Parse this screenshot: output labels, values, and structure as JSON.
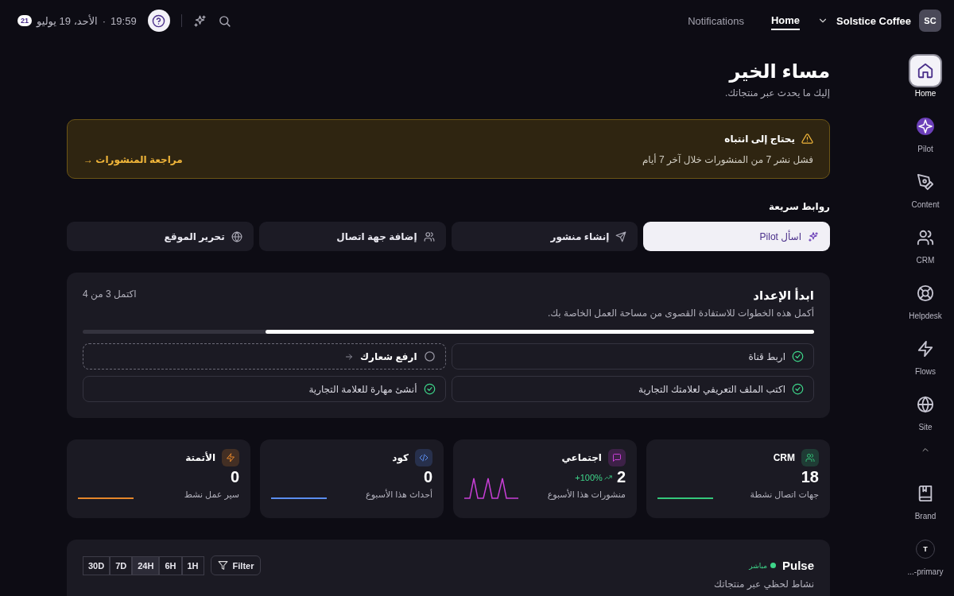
{
  "topbar": {
    "avatar": "SC",
    "workspace": "Solstice Coffee",
    "nav": [
      {
        "label": "Home",
        "selected": true
      },
      {
        "label": "Notifications",
        "selected": false
      }
    ],
    "time": "19:59",
    "separator": "·",
    "date": "الأحد، 19 يوليو",
    "badge": "21"
  },
  "sidebar": {
    "items": [
      {
        "label": "Home",
        "selected": true
      },
      {
        "label": "Pilot",
        "selected": false
      },
      {
        "label": "Content",
        "selected": false
      },
      {
        "label": "CRM",
        "selected": false
      },
      {
        "label": "Helpdesk",
        "selected": false
      },
      {
        "label": "Flows",
        "selected": false
      },
      {
        "label": "Site",
        "selected": false
      }
    ],
    "bottom": [
      {
        "kind": "icon",
        "label": "Brand"
      },
      {
        "kind": "avatar",
        "avatar": "T",
        "label": "...-primary"
      }
    ]
  },
  "greeting": {
    "title": "مساء الخير",
    "subtitle": "إليك ما يحدث عبر منتجاتك."
  },
  "alert": {
    "title": "يحتاج إلى انتباه",
    "text": "فشل نشر 7 من المنشورات خلال آخر 7 أيام",
    "link": "مراجعة المنشورات →"
  },
  "quick_links": {
    "title": "روابط سريعة",
    "items": [
      {
        "label": "اسأل Pilot",
        "primary": true
      },
      {
        "label": "إنشاء منشور",
        "primary": false
      },
      {
        "label": "إضافة جهة اتصال",
        "primary": false
      },
      {
        "label": "تحرير الموقع",
        "primary": false
      }
    ]
  },
  "setup": {
    "title": "ابدأ الإعداد",
    "subtitle": "أكمل هذه الخطوات للاستفادة القصوى من مساحة العمل الخاصة بك.",
    "count": "اكتمل 3 من 4",
    "level": 0.75,
    "steps": [
      {
        "label": "اربط قناة",
        "done": true
      },
      {
        "label": "ارفع شعارك",
        "done": false
      },
      {
        "label": "اكتب الملف التعريفي لعلامتك التجارية",
        "done": true
      },
      {
        "label": "أنشئ مهارة للعلامة التجارية",
        "done": true
      }
    ]
  },
  "stats": [
    {
      "title": "CRM",
      "value": "18",
      "caption": "جهات اتصال نشطة",
      "color": "#34c77b",
      "kind": "flat"
    },
    {
      "title": "اجتماعي",
      "value": "2",
      "change": "+100%",
      "caption": "منشورات هذا الأسبوع",
      "color": "#c83fd6",
      "kind": "sparkline"
    },
    {
      "title": "كود",
      "value": "0",
      "caption": "أحداث هذا الأسبوع",
      "color": "#5b8def",
      "kind": "flat"
    },
    {
      "title": "الأتمتة",
      "value": "0",
      "caption": "سير عمل نشط",
      "color": "#e5862a",
      "kind": "flat"
    }
  ],
  "pulse": {
    "title": "Pulse",
    "live": "مباشر",
    "subtitle": "نشاط لحظي عبر منتجاتك",
    "filter": "Filter",
    "ranges": [
      {
        "label": "1H",
        "selected": false
      },
      {
        "label": "6H",
        "selected": false
      },
      {
        "label": "24H",
        "selected": true
      },
      {
        "label": "7D",
        "selected": false
      },
      {
        "label": "30D",
        "selected": false
      }
    ]
  }
}
